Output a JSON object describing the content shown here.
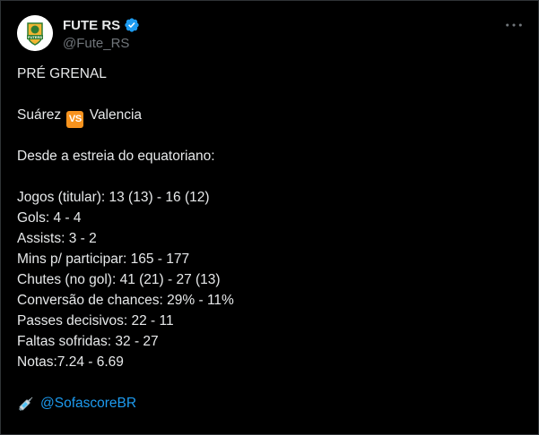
{
  "author": {
    "display_name": "FUTE RS",
    "handle": "@Fute_RS",
    "verified": true,
    "avatar_text": "FUTERS"
  },
  "more_icon": "more-dots-icon",
  "tweet": {
    "title": "PRÉ GRENAL",
    "matchup": {
      "left": "Suárez",
      "vs": "VS",
      "right": "Valencia"
    },
    "intro": "Desde a estreia do equatoriano:",
    "stats": [
      "Jogos (titular): 13 (13) - 16 (12)",
      "Gols: 4 - 4",
      "Assists: 3 - 2",
      "Mins p/ participar: 165 - 177",
      "Chutes (no gol): 41 (21) - 27 (13)",
      "Conversão de chances: 29% - 11%",
      "Passes decisivos: 22 - 11",
      "Faltas sofridas: 32 - 27",
      "Notas:7.24 - 6.69"
    ],
    "source_icon": "syringe-icon",
    "source_mention": "@SofascoreBR"
  },
  "colors": {
    "background": "#000000",
    "text": "#e7e9ea",
    "secondary": "#71767b",
    "link": "#1d9bf0",
    "verified": "#1d9bf0",
    "vs_badge": "#f7931e"
  }
}
